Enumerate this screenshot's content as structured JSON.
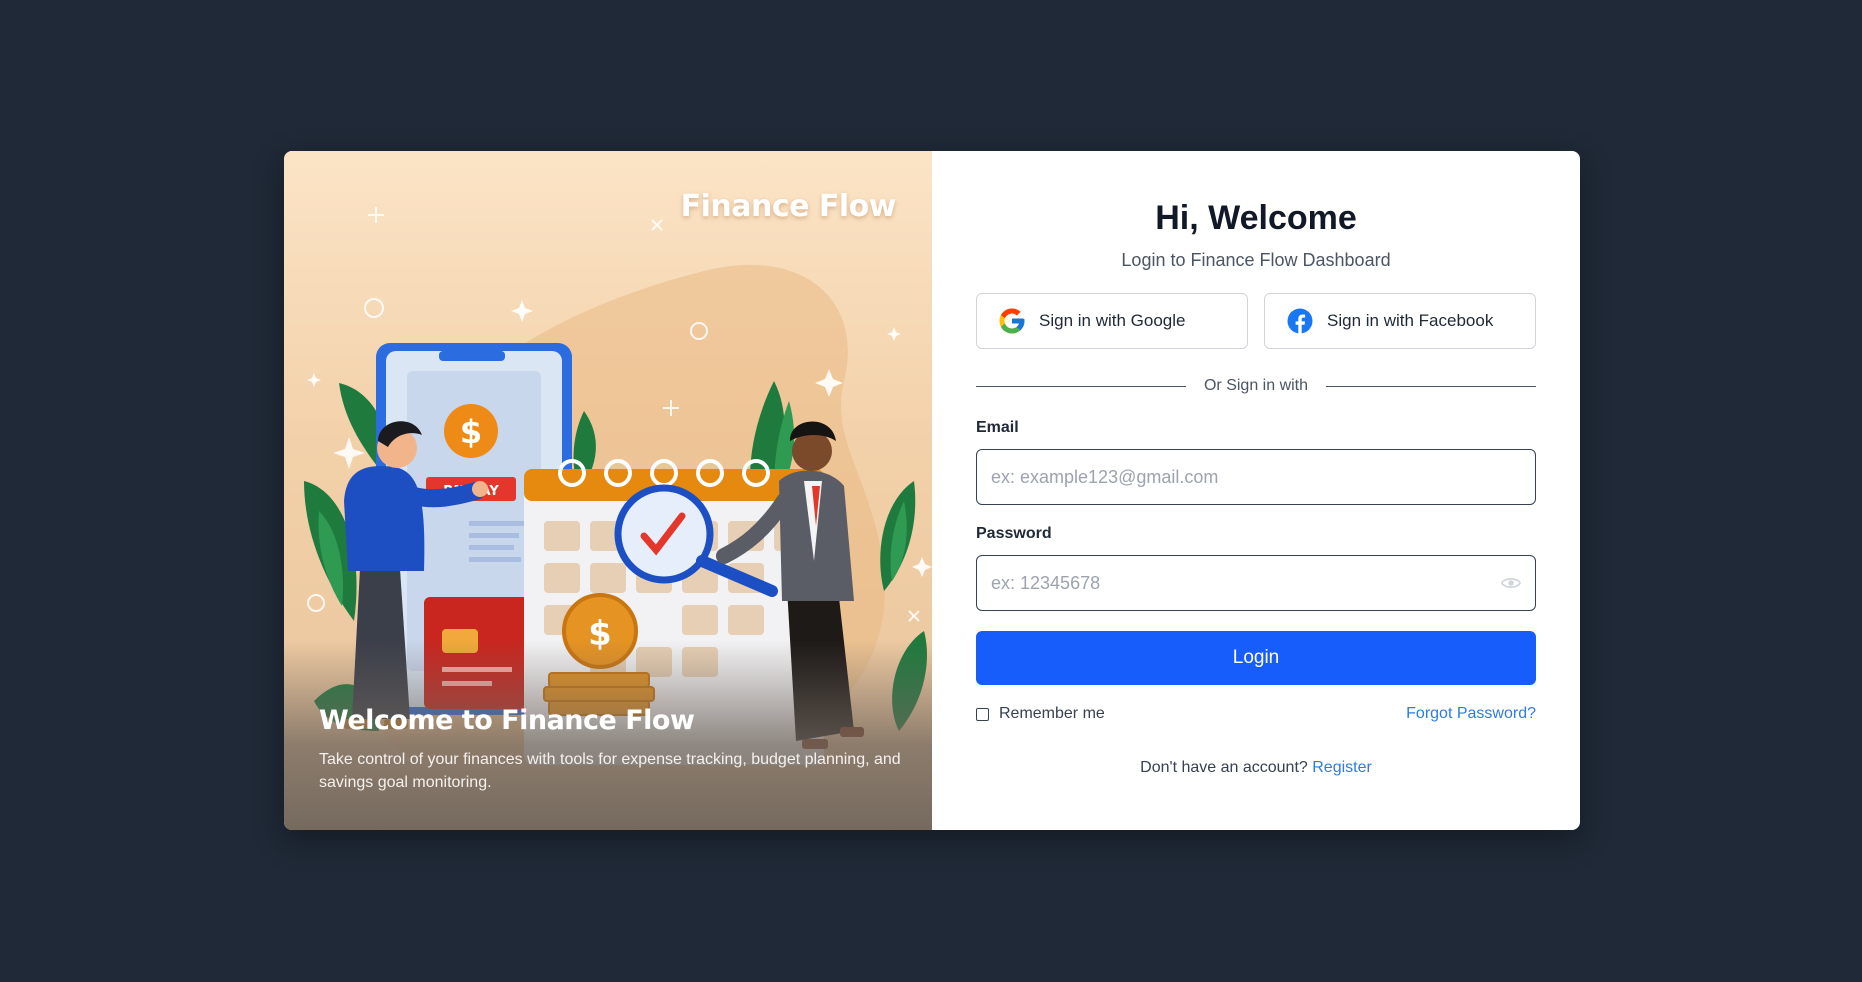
{
  "hero": {
    "brand": "Finance Flow",
    "payday_tag": "PAYDAY",
    "heading": "Welcome to Finance Flow",
    "description": "Take control of your finances with tools for expense tracking, budget planning, and savings goal monitoring."
  },
  "form": {
    "title": "Hi, Welcome",
    "subtitle": "Login to Finance Flow Dashboard",
    "google_label": "Sign in with Google",
    "facebook_label": "Sign in with Facebook",
    "divider_text": "Or Sign in with",
    "email_label": "Email",
    "email_placeholder": "ex: example123@gmail.com",
    "password_label": "Password",
    "password_placeholder": "ex: 12345678",
    "login_label": "Login",
    "remember_label": "Remember me",
    "forgot_label": "Forgot Password?",
    "register_prompt": "Don't have an account?",
    "register_link": "Register"
  },
  "colors": {
    "background": "#1f2937",
    "primary": "#165dfc",
    "link": "#2f7be0",
    "hero_gradient_top": "#fbe4c6"
  },
  "icons": {
    "google": "google-icon",
    "facebook": "facebook-icon",
    "password_toggle": "eye-icon"
  }
}
